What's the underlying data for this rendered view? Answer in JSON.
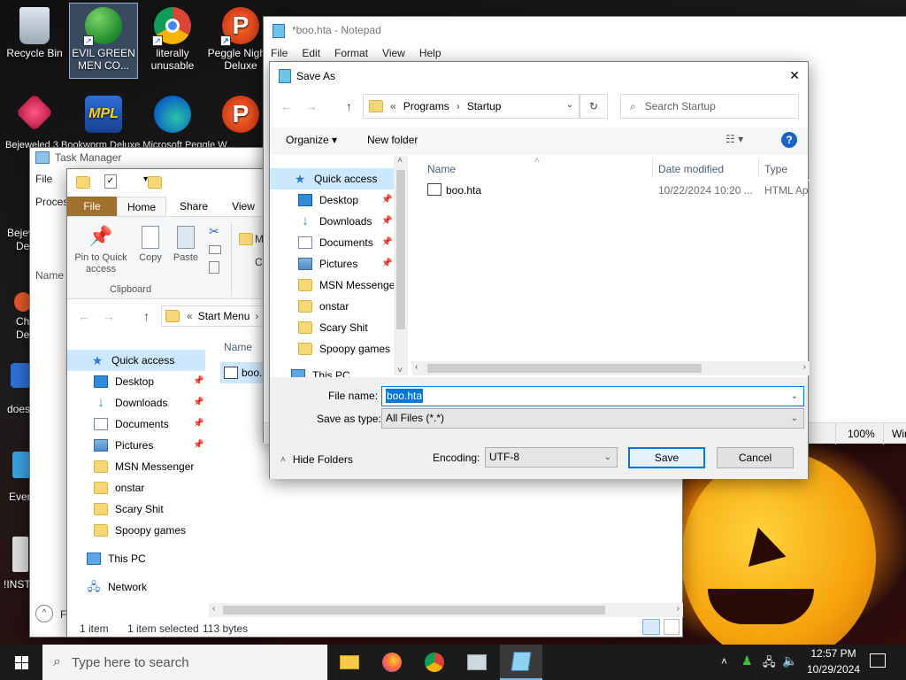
{
  "desktop": {
    "icons": [
      {
        "label": "Recycle Bin",
        "icon": "recycle-bin-icon"
      },
      {
        "label": "EVIL GREEN MEN CO...",
        "icon": "msn-messenger-icon"
      },
      {
        "label": "literally unusable",
        "icon": "chrome-icon"
      },
      {
        "label": "Peggle Nights Deluxe",
        "icon": "peggle-icon"
      }
    ],
    "icons_row2": [
      {
        "label": "Bejeweled Deluxe",
        "icon": "bejeweled-icon"
      },
      {
        "label": "Mahjong",
        "icon": "mahjong-icon"
      },
      {
        "label": "Microsoft Edge",
        "icon": "edge-icon"
      },
      {
        "label": "Peggle Deluxe",
        "icon": "peggle-icon"
      }
    ],
    "row2_partial_text": "Bejeweled 3  Bookworm Deluxe  Microsoft  Peggle W..."
  },
  "left_partial_labels": [
    "Bejeweled",
    "Deluxe",
    "Chrome",
    "Deluxe",
    "does",
    "Ever",
    "!INSTA"
  ],
  "task_manager": {
    "title": "Task Manager",
    "menu_file": "File",
    "tab_processes": "Process",
    "col_name": "Name",
    "footer": "F"
  },
  "explorer": {
    "ribbon_tabs": [
      "File",
      "Home",
      "Share",
      "View"
    ],
    "clipboard": {
      "pin_label": "Pin to Quick access",
      "copy_label": "Copy",
      "paste_label": "Paste",
      "group_label": "Clipboard",
      "move_partial": "M",
      "copy_partial": "Co"
    },
    "path": {
      "prefix": "«",
      "folder": "Start Menu",
      "sep": "›"
    },
    "col_name": "Name",
    "file_partial": "boo.",
    "nav": {
      "quick_access": "Quick access",
      "items": [
        {
          "label": "Desktop",
          "icon": "desktop-icon",
          "pinned": true
        },
        {
          "label": "Downloads",
          "icon": "downloads-icon",
          "pinned": true
        },
        {
          "label": "Documents",
          "icon": "documents-icon",
          "pinned": true
        },
        {
          "label": "Pictures",
          "icon": "pictures-icon",
          "pinned": true
        },
        {
          "label": "MSN Messenger",
          "icon": "folder-icon",
          "pinned": false
        },
        {
          "label": "onstar",
          "icon": "folder-icon",
          "pinned": false
        },
        {
          "label": "Scary Shit",
          "icon": "folder-icon",
          "pinned": false
        },
        {
          "label": "Spoopy games",
          "icon": "folder-icon",
          "pinned": false
        }
      ],
      "this_pc": "This PC",
      "network": "Network"
    },
    "status": {
      "items": "1 item",
      "selected": "1 item selected",
      "size": "113 bytes"
    }
  },
  "notepad": {
    "title": "*boo.hta - Notepad",
    "menu": [
      "File",
      "Edit",
      "Format",
      "View",
      "Help"
    ],
    "zoom": "100%",
    "status_partial": "Win"
  },
  "save_as": {
    "title": "Save As",
    "close_glyph": "✕",
    "path": {
      "prefix": "«",
      "part1": "Programs",
      "sep": "›",
      "part2": "Startup"
    },
    "search_placeholder": "Search Startup",
    "toolbar": {
      "organize": "Organize ▾",
      "new_folder": "New folder",
      "help": "?"
    },
    "nav": {
      "quick_access": "Quick access",
      "items": [
        {
          "label": "Desktop",
          "icon": "desktop-icon",
          "pinned": true
        },
        {
          "label": "Downloads",
          "icon": "downloads-icon",
          "pinned": true
        },
        {
          "label": "Documents",
          "icon": "documents-icon",
          "pinned": true
        },
        {
          "label": "Pictures",
          "icon": "pictures-icon",
          "pinned": true
        },
        {
          "label": "MSN Messenger",
          "icon": "folder-icon",
          "pinned": false
        },
        {
          "label": "onstar",
          "icon": "folder-icon",
          "pinned": false
        },
        {
          "label": "Scary Shit",
          "icon": "folder-icon",
          "pinned": false
        },
        {
          "label": "Spoopy games",
          "icon": "folder-icon",
          "pinned": false
        }
      ],
      "this_pc_partial": "This PC"
    },
    "columns": {
      "name": "Name",
      "date": "Date modified",
      "type": "Type"
    },
    "files": [
      {
        "name": "boo.hta",
        "date": "10/22/2024 10:20 ...",
        "type": "HTML Ap"
      }
    ],
    "file_name_label": "File name:",
    "file_name_value": "boo.hta",
    "save_type_label": "Save as type:",
    "save_type_value": "All Files  (*.*)",
    "hide_folders": "Hide Folders",
    "encoding_label": "Encoding:",
    "encoding_value": "UTF-8",
    "save_button": "Save",
    "cancel_button": "Cancel"
  },
  "taskbar": {
    "search_placeholder": "Type here to search",
    "apps": [
      "file-explorer-icon",
      "firefox-icon",
      "chrome-icon",
      "msn-messenger-icon",
      "notepad-icon"
    ],
    "time": "12:57 PM",
    "date": "10/29/2024"
  },
  "colors": {
    "accent": "#0078d7",
    "ribbon_file": "#a0702e",
    "selection": "#cce8ff"
  }
}
